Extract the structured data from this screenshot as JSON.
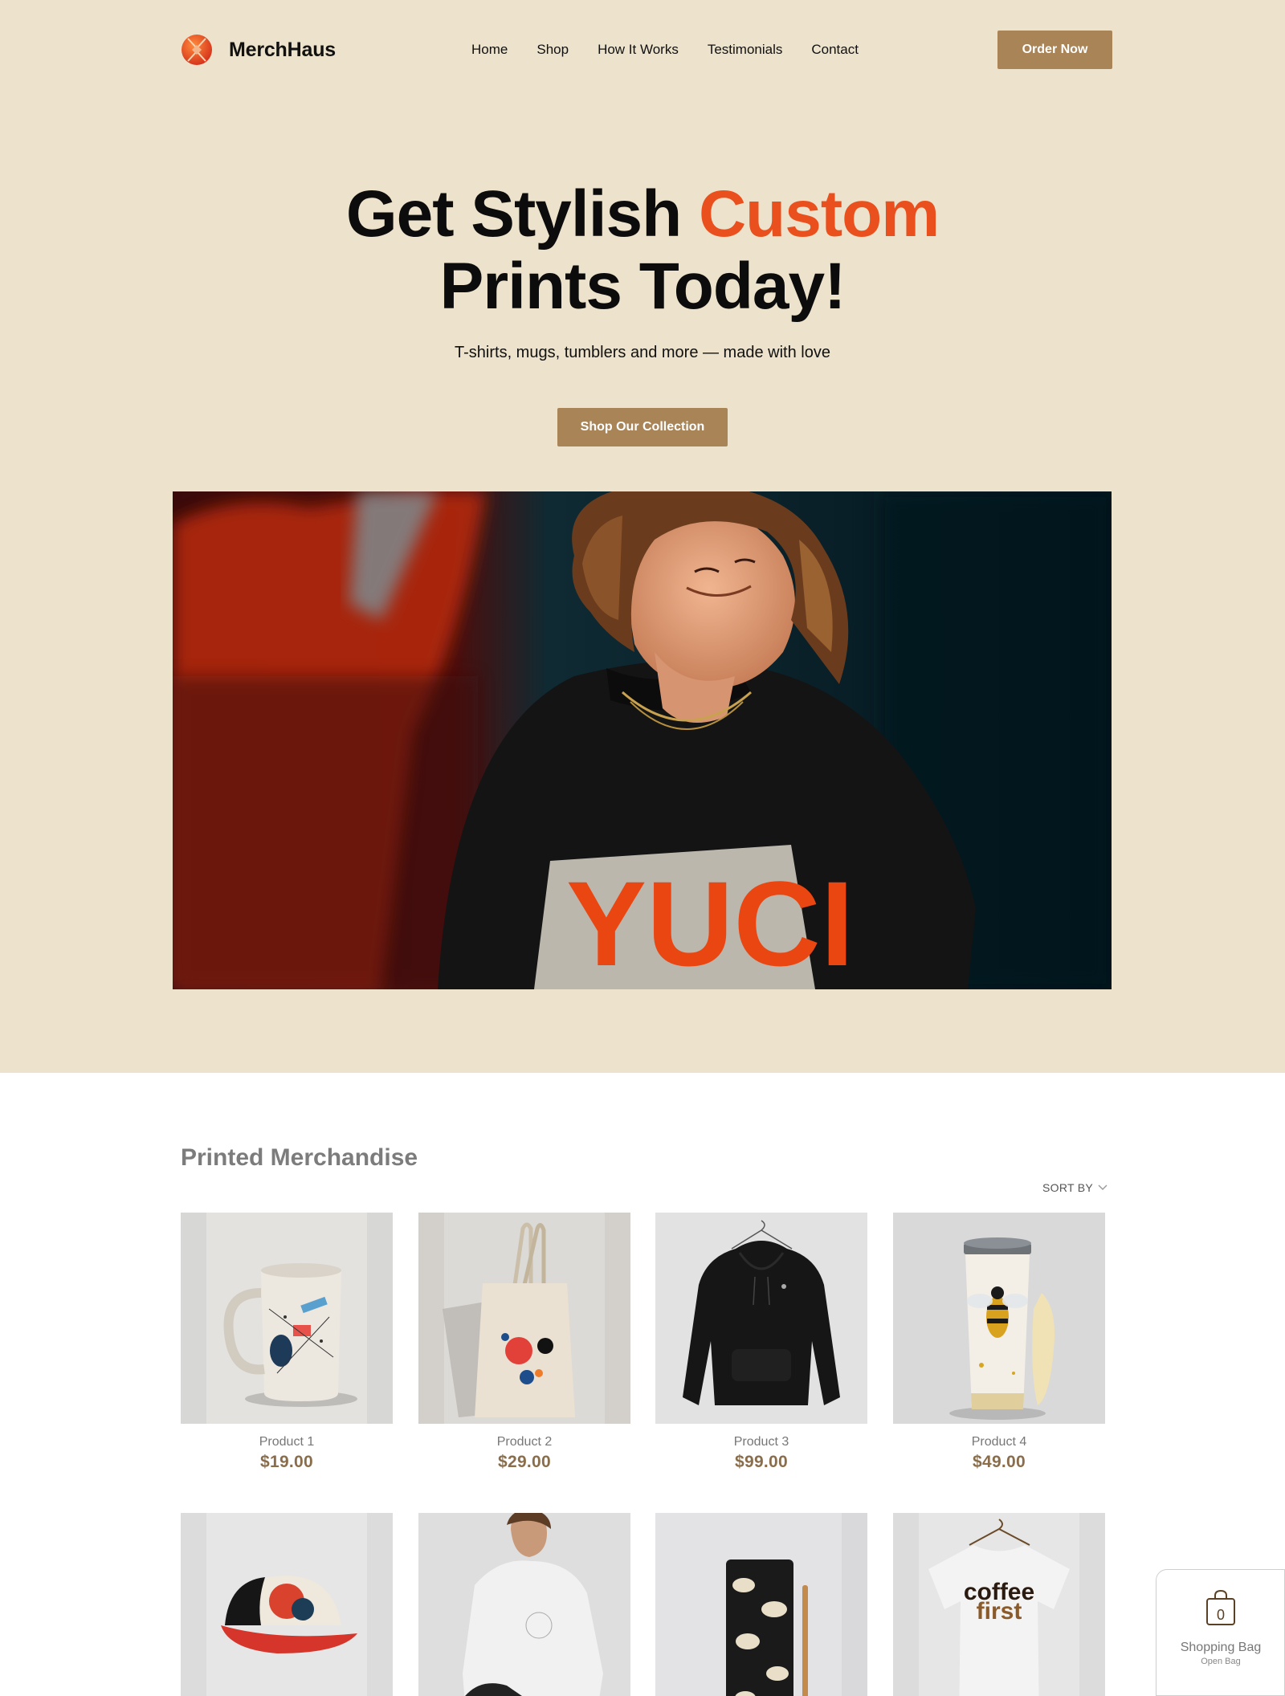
{
  "brand": {
    "name": "MerchHaus",
    "logo_icon": "merchhaus-logo-icon",
    "accent_color": "#ea501e",
    "button_color": "#a98456"
  },
  "nav": {
    "items": [
      {
        "label": "Home"
      },
      {
        "label": "Shop"
      },
      {
        "label": "How It Works"
      },
      {
        "label": "Testimonials"
      },
      {
        "label": "Contact"
      }
    ],
    "order_label": "Order Now"
  },
  "hero": {
    "headline_part1": "Get Stylish ",
    "headline_accent": "Custom",
    "headline_part2": "Prints Today!",
    "subtitle": "T-shirts, mugs, tumblers and more — made with love",
    "cta_label": "Shop Our Collection",
    "image_text": "YUCI",
    "background_color": "#ede2cb"
  },
  "products_section": {
    "title": "Printed Merchandise",
    "sort_label": "SORT BY",
    "sort_icon": "chevron-down-icon",
    "products": [
      {
        "name": "Product 1",
        "price": "$19.00",
        "kind": "mug"
      },
      {
        "name": "Product 2",
        "price": "$29.00",
        "kind": "tote-bag"
      },
      {
        "name": "Product 3",
        "price": "$99.00",
        "kind": "hoodie"
      },
      {
        "name": "Product 4",
        "price": "$49.00",
        "kind": "tumbler"
      },
      {
        "name": "",
        "price": "",
        "kind": "cap"
      },
      {
        "name": "",
        "price": "",
        "kind": "long-sleeve-shirt"
      },
      {
        "name": "",
        "price": "",
        "kind": "notebook"
      },
      {
        "name": "",
        "price": "",
        "kind": "t-shirt",
        "print_text_line1": "coffee",
        "print_text_line2": "first"
      }
    ]
  },
  "shopping_bag": {
    "count": "0",
    "title": "Shopping Bag",
    "subtitle": "Open Bag",
    "icon": "shopping-bag-icon"
  }
}
